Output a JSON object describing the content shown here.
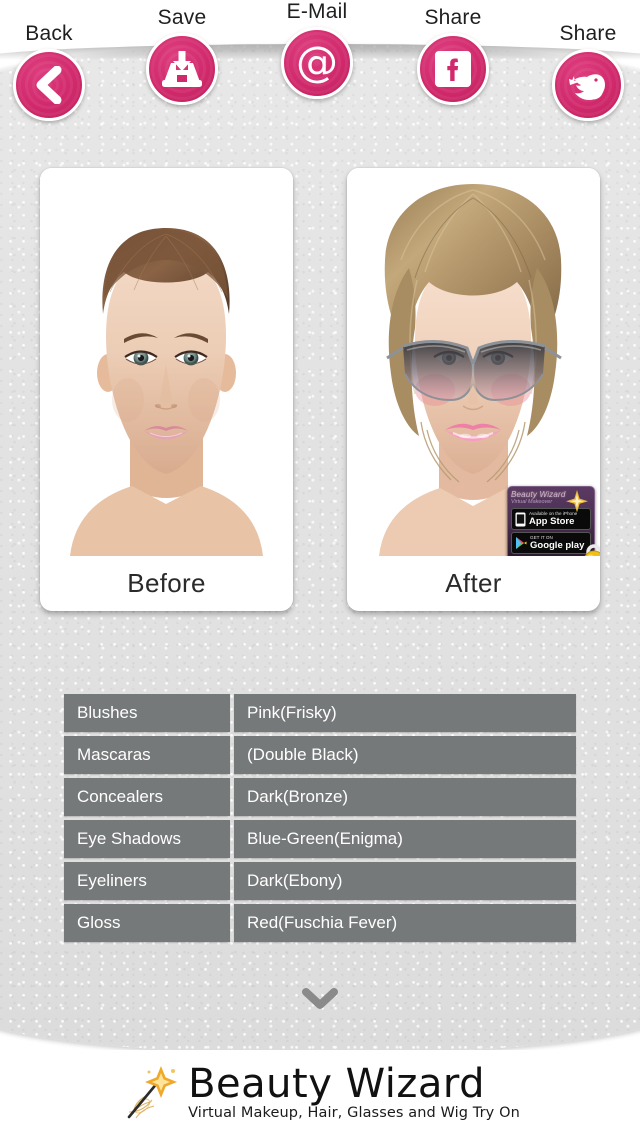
{
  "app": {
    "brand_name": "Beauty Wizard",
    "brand_tagline": "Virtual Makeup, Hair, Glasses and Wig Try On"
  },
  "colors": {
    "accent_pink": "#D12A6C",
    "stage_gray": "#E3E3E3",
    "row_gray": "#76797A",
    "row_text": "#FFFFFF",
    "lock_gold": "#F5C518"
  },
  "toolbar": {
    "buttons": [
      {
        "label": "Back",
        "icon": "chevron-left-icon"
      },
      {
        "label": "Save",
        "icon": "save-tray-icon"
      },
      {
        "label": "E-Mail",
        "icon": "at-sign-icon"
      },
      {
        "label": "Share",
        "icon": "facebook-icon"
      },
      {
        "label": "Share",
        "icon": "twitter-bird-icon"
      }
    ]
  },
  "cards": {
    "before": {
      "caption": "Before"
    },
    "after": {
      "caption": "After"
    }
  },
  "watermark": {
    "title": "Beauty Wizard",
    "subtitle": "Virtual Makeover",
    "appstore_small": "Available on the iPhone",
    "appstore_big": "App Store",
    "googleplay_small": "GET IT ON",
    "googleplay_big": "Google play",
    "lock_icon": "padlock-icon"
  },
  "makeup_table": {
    "rows": [
      {
        "category": "Blushes",
        "value": "Pink(Frisky)"
      },
      {
        "category": "Mascaras",
        "value": "(Double Black)"
      },
      {
        "category": "Concealers",
        "value": "Dark(Bronze)"
      },
      {
        "category": "Eye Shadows",
        "value": "Blue-Green(Enigma)"
      },
      {
        "category": "Eyeliners",
        "value": "Dark(Ebony)"
      },
      {
        "category": "Gloss",
        "value": "Red(Fuschia Fever)"
      }
    ]
  },
  "scroll_hint": {
    "icon": "chevron-down-icon"
  }
}
